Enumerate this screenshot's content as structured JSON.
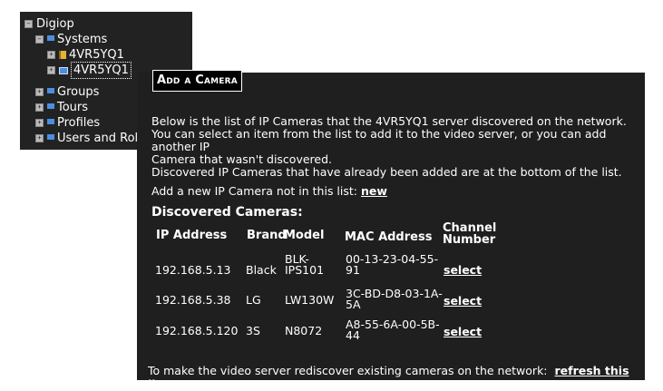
{
  "tree": {
    "root": "Digiop",
    "systems": "Systems",
    "server1": "4VR5YQ1",
    "server2": "4VR5YQ1",
    "groups": "Groups",
    "tours": "Tours",
    "profiles": "Profiles",
    "users": "Users and Role"
  },
  "dialog": {
    "title": "Add a Camera",
    "intro1": "Below is the list of IP Cameras that the 4VR5YQ1 server discovered on the network.",
    "intro2": "You can select an item from the list to add it to the video server, or you can add another IP",
    "intro3": "Camera that wasn't discovered.",
    "intro4": "Discovered IP Cameras that have already been added are at the bottom of the list.",
    "add_new_text": "Add a new IP Camera not in this list:",
    "add_new_link": "new",
    "discovered_heading": "Discovered Cameras:",
    "columns": {
      "ip": "IP Address",
      "brand": "Brand",
      "model": "Model",
      "mac": "MAC Address",
      "channel1": "Channel",
      "channel2": "Number"
    },
    "rows": [
      {
        "ip": "192.168.5.13",
        "brand": "Black",
        "model1": "BLK-",
        "model2": "IPS101",
        "mac1": "00-13-23-04-55-",
        "mac2": "91",
        "action": "select"
      },
      {
        "ip": "192.168.5.38",
        "brand": "LG",
        "model1": "LW130W",
        "model2": "",
        "mac1": "3C-BD-D8-03-1A-",
        "mac2": "5A",
        "action": "select"
      },
      {
        "ip": "192.168.5.120",
        "brand": "3S",
        "model1": "N8072",
        "model2": "",
        "mac1": "A8-55-6A-00-5B-",
        "mac2": "44",
        "action": "select"
      }
    ],
    "footer_text": "To make the video server rediscover existing cameras on the network:",
    "footer_link": "refresh this list"
  }
}
